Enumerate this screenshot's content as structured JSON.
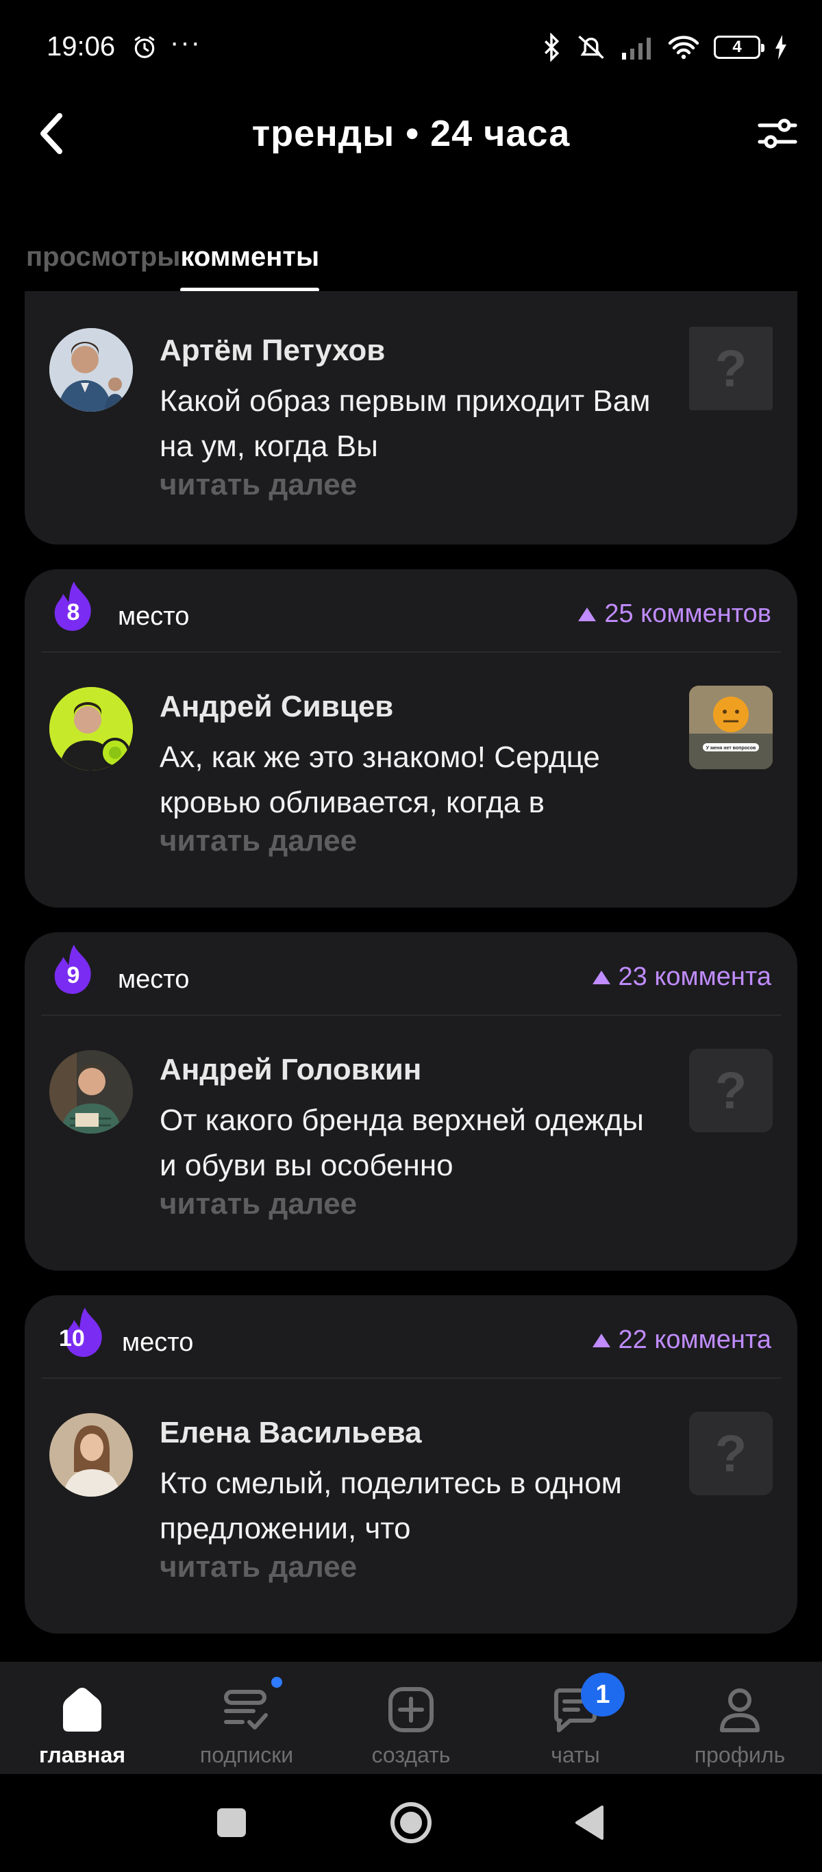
{
  "status": {
    "time": "19:06",
    "dots": "···",
    "battery": "4"
  },
  "header": {
    "title": "тренды • 24 часа"
  },
  "tabs": [
    {
      "label": "просмотры",
      "active": false
    },
    {
      "label": "комменты",
      "active": true
    }
  ],
  "cards": [
    {
      "author": "Артём Петухов",
      "text": "Какой образ первым приходит Вам на ум, когда Вы",
      "read_more": "читать далее",
      "thumb": "?"
    },
    {
      "place_num": "8",
      "place_label": "место",
      "comments": "25 комментов",
      "author": "Андрей Сивцев",
      "text": "Ах, как же это знакомо! Сердце кровью обливается, когда в",
      "read_more": "читать далее",
      "thumb_caption": "У меня нет вопросов"
    },
    {
      "place_num": "9",
      "place_label": "место",
      "comments": "23 коммента",
      "author": "Андрей Головкин",
      "text": "От какого бренда верхней одежды и обуви вы особенно",
      "read_more": "читать далее",
      "thumb": "?"
    },
    {
      "place_num": "10",
      "place_label": "место",
      "comments": "22 коммента",
      "author": "Елена Васильева",
      "text": "Кто смелый, поделитесь в одном предложении, что",
      "read_more": "читать далее",
      "thumb": "?"
    }
  ],
  "bottom_nav": [
    {
      "label": "главная",
      "icon": "home-icon",
      "active": true
    },
    {
      "label": "подписки",
      "icon": "subscriptions-icon",
      "active": false
    },
    {
      "label": "создать",
      "icon": "create-icon",
      "active": false
    },
    {
      "label": "чаты",
      "icon": "chat-icon",
      "active": false,
      "badge": "1"
    },
    {
      "label": "профиль",
      "icon": "profile-icon",
      "active": false
    }
  ],
  "colors": {
    "background": "#000000",
    "card": "#1c1c1e",
    "accent_purple": "#c08cff",
    "muted": "#5e5e60",
    "badge_blue": "#1f6bf0"
  }
}
